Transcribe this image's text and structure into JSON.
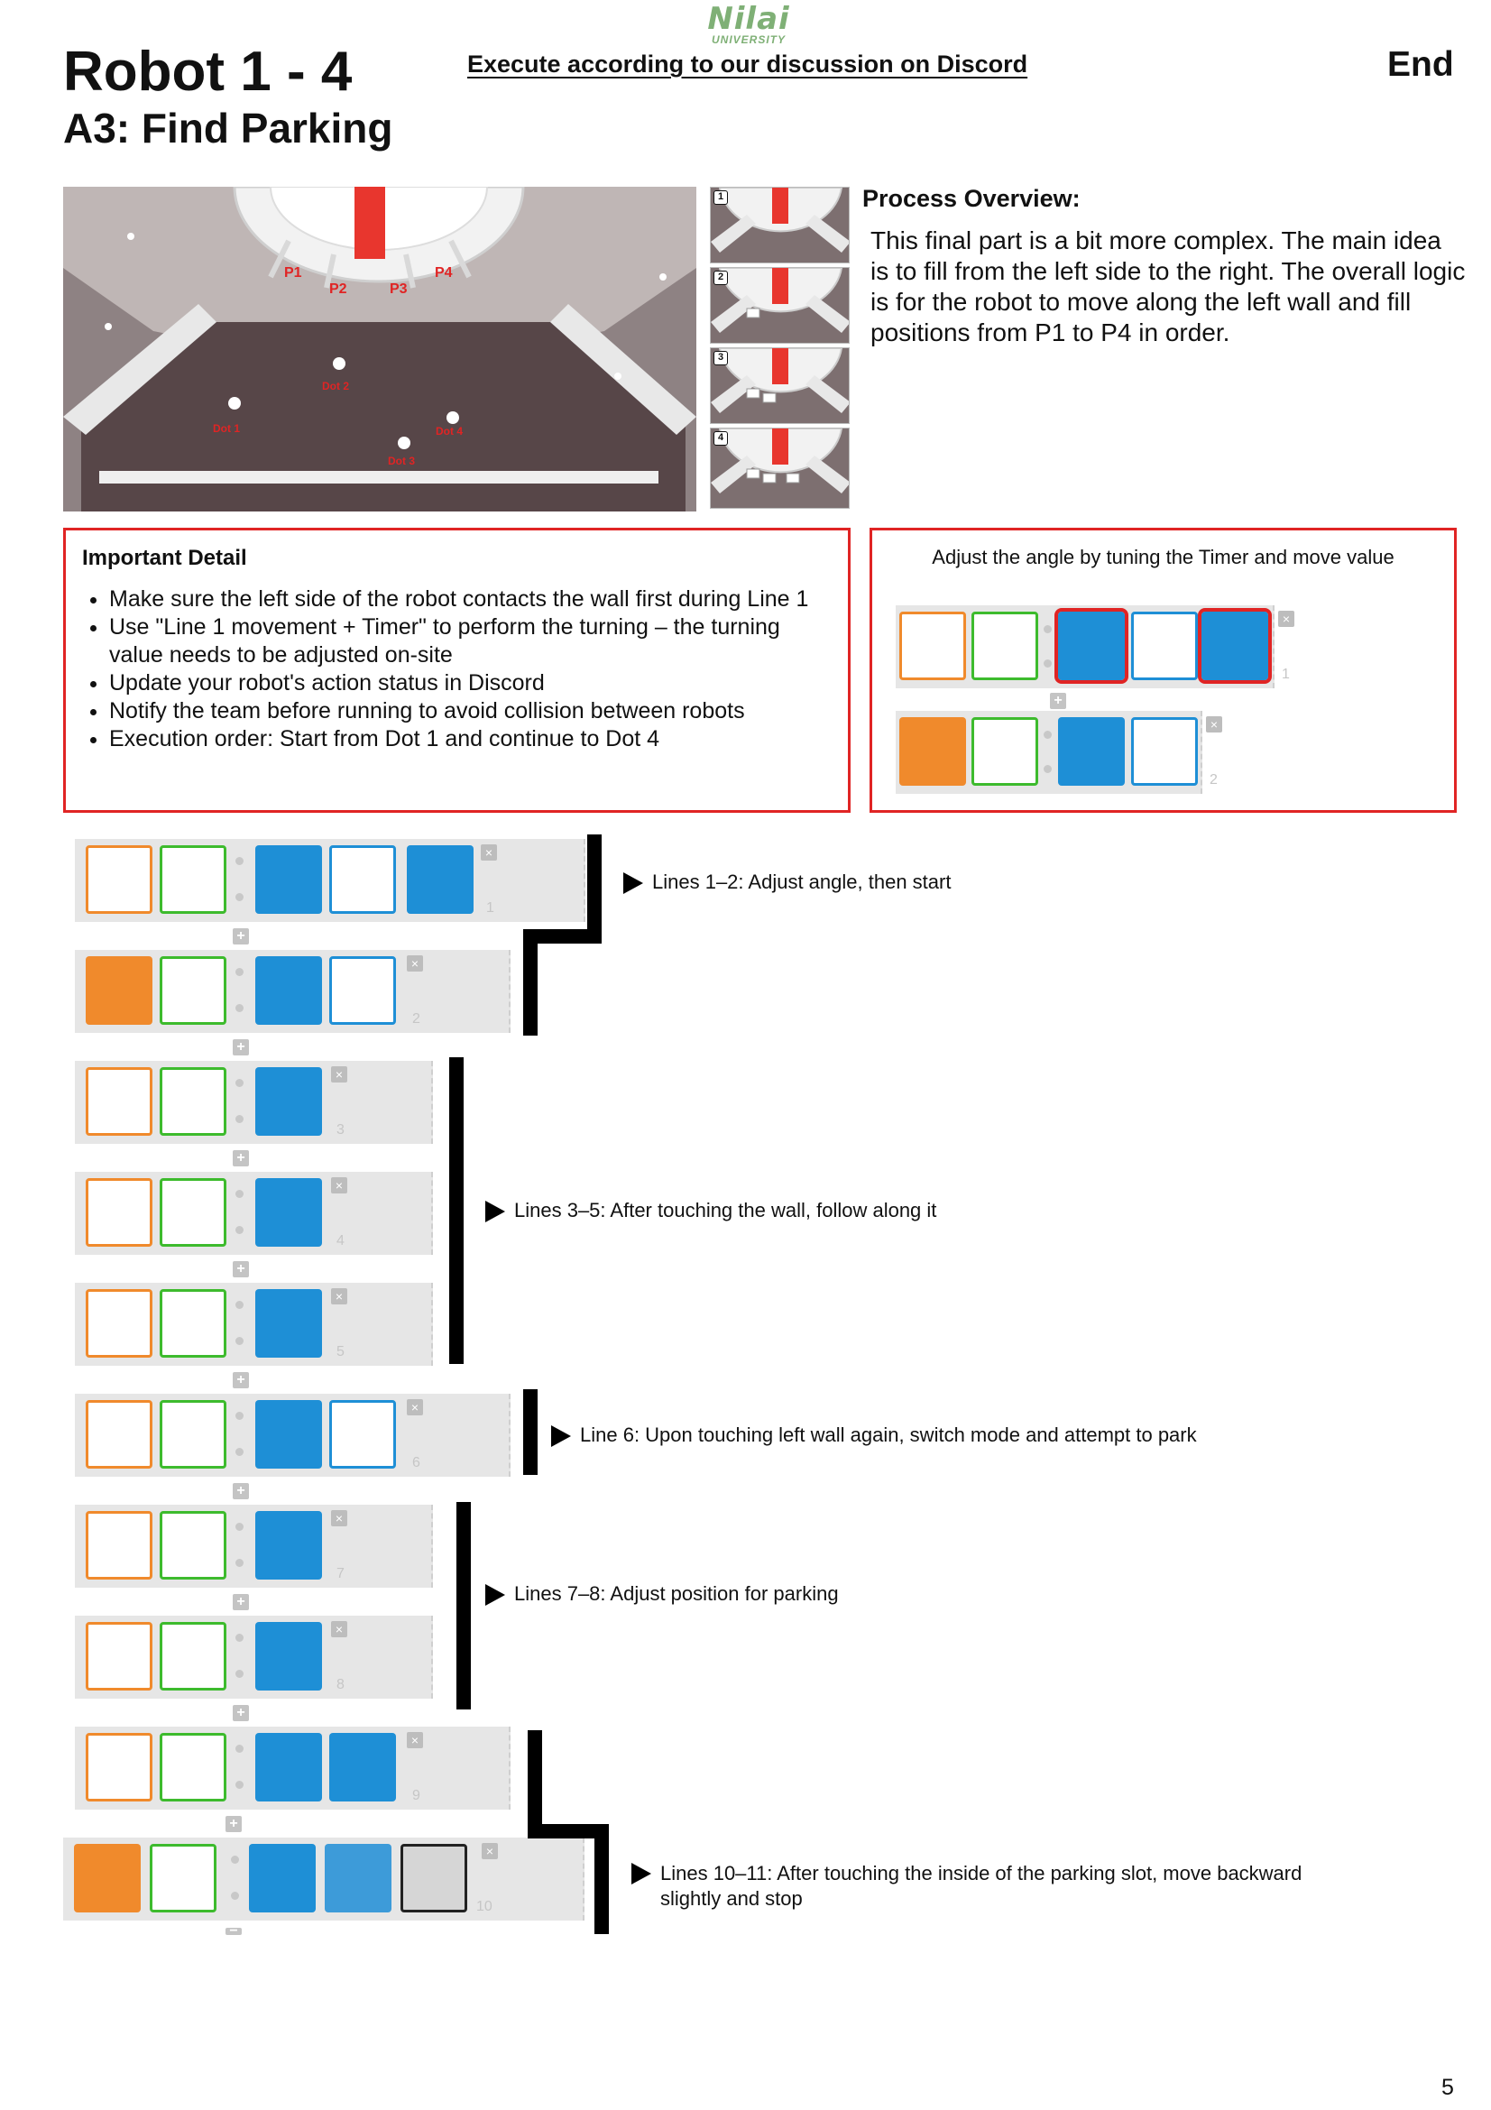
{
  "header": {
    "logo_main": "Nilai",
    "logo_sub": "UNIVERSITY",
    "title": "Robot 1 - 4",
    "subtitle": "A3: Find Parking",
    "instruction": "Execute according to our discussion on Discord",
    "end_label": "End"
  },
  "hero": {
    "parking_labels": [
      "P1",
      "P2",
      "P3",
      "P4"
    ],
    "dot_labels": [
      "Dot 1",
      "Dot 2",
      "Dot 3",
      "Dot 4"
    ],
    "thumb_numbers": [
      "1",
      "2",
      "3",
      "4"
    ]
  },
  "overview": {
    "title": "Process Overview:",
    "text": "This final part is a bit more complex. The main idea is to fill from the left side to the right. The overall logic is for the robot to move along the left wall and fill positions from P1 to P4 in order."
  },
  "important": {
    "title": "Important Detail",
    "items": [
      "Make sure the left side of the robot contacts the wall first during Line 1",
      "Use \"Line 1 movement + Timer\" to perform the turning – the turning value needs to be adjusted on-site",
      "Update your robot's action status in Discord",
      "Notify the team before running to avoid collision between robots",
      "Execution order: Start from Dot 1 and continue to Dot 4"
    ]
  },
  "adjust": {
    "title": "Adjust the angle by tuning the Timer and move value",
    "line_numbers": [
      "1",
      "2"
    ]
  },
  "program": {
    "line_numbers": [
      "1",
      "2",
      "3",
      "4",
      "5",
      "6",
      "7",
      "8",
      "9",
      "10"
    ],
    "close_symbol": "×",
    "plus_symbol": "+",
    "minus_symbol": "−",
    "notes": [
      "Lines 1–2: Adjust angle, then start",
      "Lines 3–5: After touching the wall, follow along it",
      "Line 6: Upon touching left wall again, switch mode and attempt to park",
      "Lines 7–8: Adjust position for parking",
      "Lines 10–11: After touching the inside of the parking slot, move backward slightly and stop"
    ]
  },
  "colors": {
    "accent_red": "#e02424",
    "block_blue": "#1e8fd6",
    "block_orange": "#f08a2c",
    "block_green": "#3dbb2d",
    "logo_green": "#7fb076"
  },
  "footer": {
    "page_number": "5"
  }
}
